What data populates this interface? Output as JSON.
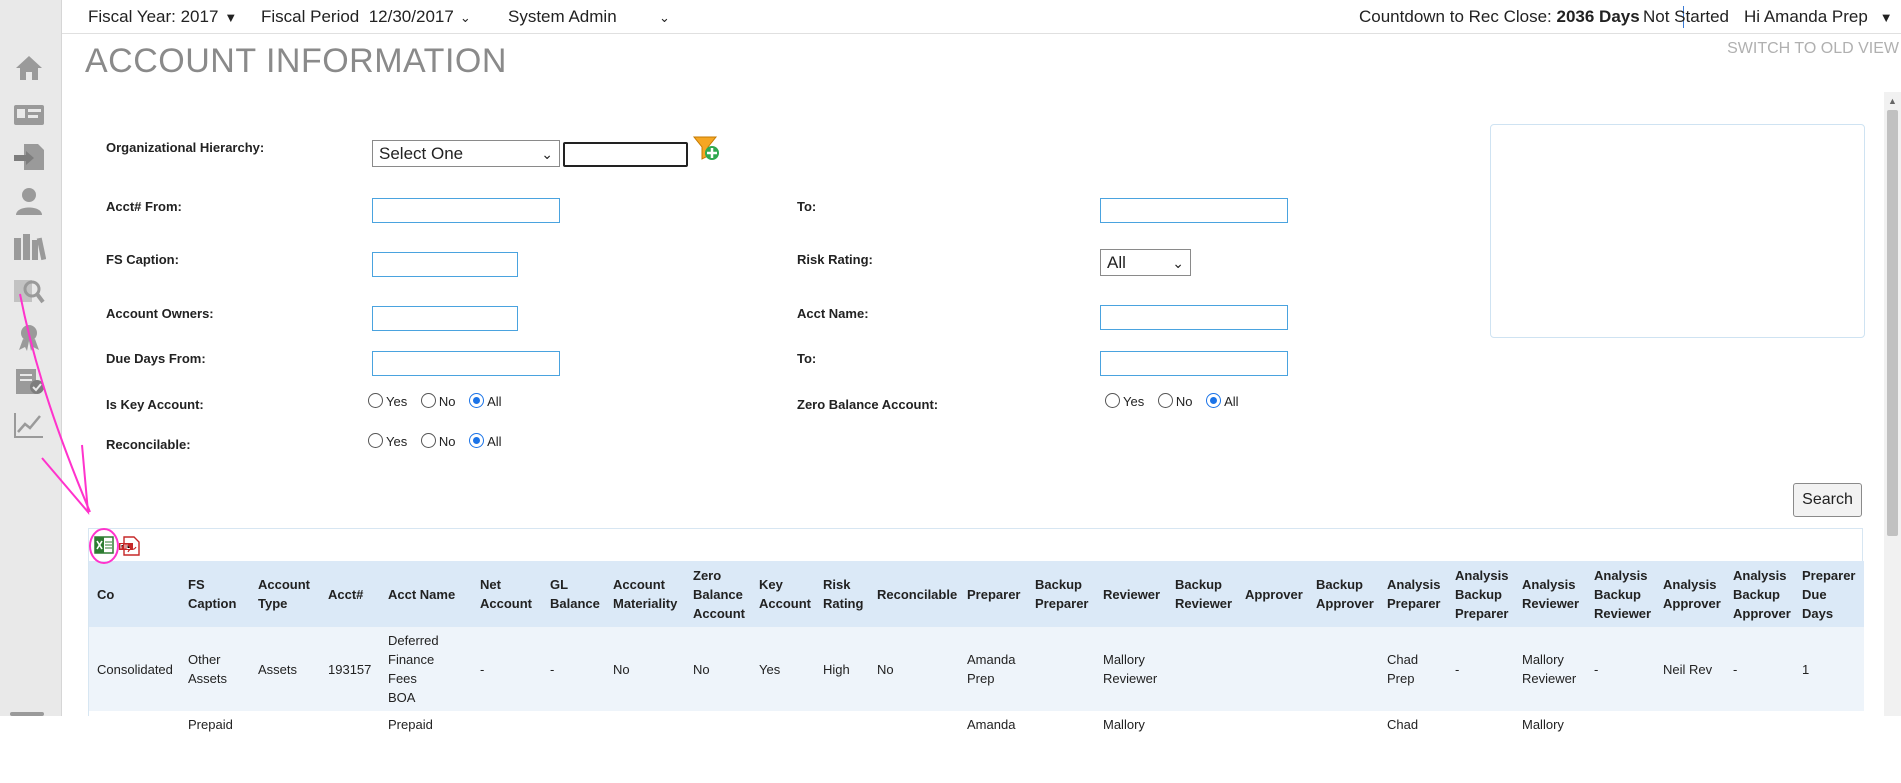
{
  "topbar": {
    "fiscal_year": "Fiscal Year: 2017",
    "fiscal_period_label": "Fiscal Period",
    "fiscal_period_value": "12/30/2017",
    "role": "System Admin",
    "countdown_label": "Countdown to Rec Close:",
    "countdown_value": "2036 Days",
    "status": "Not Started",
    "greeting": "Hi Amanda Prep"
  },
  "page": {
    "title": "ACCOUNT INFORMATION",
    "switch_view": "SWITCH TO OLD VIEW"
  },
  "nav_icons": [
    "home-icon",
    "id-card-icon",
    "import-icon",
    "user-icon",
    "library-icon",
    "search-doc-icon",
    "award-icon",
    "checklist-icon",
    "chart-icon"
  ],
  "form": {
    "org_hierarchy_label": "Organizational Hierarchy:",
    "org_hierarchy_select": "Select One",
    "org_hierarchy_text": "",
    "acct_from_label": "Acct# From:",
    "acct_to_label": "To:",
    "fs_caption_label": "FS Caption:",
    "risk_rating_label": "Risk Rating:",
    "risk_rating_value": "All",
    "account_owners_label": "Account Owners:",
    "acct_name_label": "Acct Name:",
    "due_days_from_label": "Due Days From:",
    "due_days_to_label": "To:",
    "is_key_label": "Is Key Account:",
    "zero_balance_label": "Zero Balance Account:",
    "reconcilable_label": "Reconcilable:",
    "opt_yes": "Yes",
    "opt_no": "No",
    "opt_all": "All",
    "search_button": "Search"
  },
  "grid": {
    "columns": [
      [
        "Co"
      ],
      [
        "FS",
        "Caption"
      ],
      [
        "Account",
        "Type"
      ],
      [
        "Acct#"
      ],
      [
        "Acct Name"
      ],
      [
        "Net",
        "Account"
      ],
      [
        "GL",
        "Balance"
      ],
      [
        "Account",
        "Materiality"
      ],
      [
        "Zero",
        "Balance",
        "Account"
      ],
      [
        "Key",
        "Account"
      ],
      [
        "Risk",
        "Rating"
      ],
      [
        "Reconcilable"
      ],
      [
        "Preparer"
      ],
      [
        "Backup",
        "Preparer"
      ],
      [
        "Reviewer"
      ],
      [
        "Backup",
        "Reviewer"
      ],
      [
        "Approver"
      ],
      [
        "Backup",
        "Approver"
      ],
      [
        "Analysis",
        "Preparer"
      ],
      [
        "Analysis",
        "Backup",
        "Preparer"
      ],
      [
        "Analysis",
        "Reviewer"
      ],
      [
        "Analysis",
        "Backup",
        "Reviewer"
      ],
      [
        "Analysis",
        "Approver"
      ],
      [
        "Analysis",
        "Backup",
        "Approver"
      ],
      [
        "Preparer",
        "Due",
        "Days"
      ]
    ],
    "rows": [
      [
        [
          "Consolidated"
        ],
        [
          "Other",
          "Assets"
        ],
        [
          "Assets"
        ],
        [
          "193157"
        ],
        [
          "Deferred",
          "Finance Fees",
          "BOA"
        ],
        [
          "-"
        ],
        [
          "-"
        ],
        [
          "No"
        ],
        [
          "No"
        ],
        [
          "Yes"
        ],
        [
          "High"
        ],
        [
          "No"
        ],
        [
          "Amanda",
          "Prep"
        ],
        [
          ""
        ],
        [
          "Mallory",
          "Reviewer"
        ],
        [
          ""
        ],
        [
          ""
        ],
        [
          ""
        ],
        [
          "Chad",
          "Prep"
        ],
        [
          "-"
        ],
        [
          "Mallory",
          "Reviewer"
        ],
        [
          "-"
        ],
        [
          "Neil Rev"
        ],
        [
          "-"
        ],
        [
          "1"
        ]
      ],
      [
        [
          ""
        ],
        [
          "Prepaid"
        ],
        [
          ""
        ],
        [
          ""
        ],
        [
          "Prepaid"
        ],
        [
          ""
        ],
        [
          ""
        ],
        [
          ""
        ],
        [
          ""
        ],
        [
          ""
        ],
        [
          ""
        ],
        [
          ""
        ],
        [
          "Amanda"
        ],
        [
          ""
        ],
        [
          "Mallory"
        ],
        [
          ""
        ],
        [
          ""
        ],
        [
          ""
        ],
        [
          "Chad"
        ],
        [
          ""
        ],
        [
          "Mallory"
        ],
        [
          ""
        ],
        [
          ""
        ],
        [
          ""
        ],
        [
          ""
        ]
      ]
    ]
  },
  "colors": {
    "accent": "#4aa3df",
    "header_bg": "#dbe9f7",
    "annotation": "#ff33cc"
  }
}
